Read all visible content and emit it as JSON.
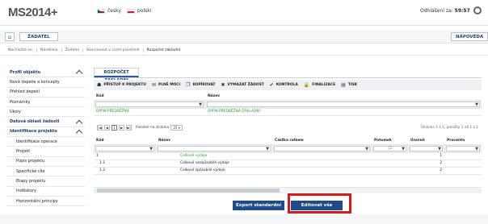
{
  "header": {
    "logo_main": "MS2014+",
    "lang_cz": "česky",
    "lang_pl": "polski",
    "logout_label": "Odhlášení za:",
    "logout_time": "59:57"
  },
  "navbar": {
    "zadatel": "ŽADATEL",
    "help": "NÁPOVĚDA"
  },
  "breadcrumb": [
    "Nacházíte se:",
    "Nástěnka",
    "Žadatel",
    "Kosmonaut v cizím prostředí",
    "Rozpočet základní"
  ],
  "sidebar": [
    {
      "label": "Profil objektu",
      "type": "sec",
      "chev": true
    },
    {
      "label": "Nová depeše a koncepty",
      "type": "item"
    },
    {
      "label": "Přehled depeší",
      "type": "item"
    },
    {
      "label": "Poznámky",
      "type": "item"
    },
    {
      "label": "Úkoly",
      "type": "item"
    },
    {
      "label": "Datová oblast žádosti",
      "type": "sec",
      "chev": true
    },
    {
      "label": "Identifikace projektu",
      "type": "sec",
      "chev": true
    },
    {
      "label": "Identifikace operace",
      "type": "sub"
    },
    {
      "label": "Projekt",
      "type": "sub"
    },
    {
      "label": "Popis projektu",
      "type": "sub"
    },
    {
      "label": "Specifické cíle",
      "type": "sub"
    },
    {
      "label": "Etapy projektu",
      "type": "sub"
    },
    {
      "label": "Indikátory",
      "type": "sub"
    },
    {
      "label": "Horizontální principy",
      "type": "sub"
    }
  ],
  "tab_title": "ROZPOČET ZÁKLADNÍ",
  "toolbar": [
    {
      "icon": "people-icon",
      "glyph": "☗",
      "label": "PŘÍSTUP K PROJEKTU"
    },
    {
      "icon": "mail-icon",
      "glyph": "✉",
      "label": "PLNÉ MOCI"
    },
    {
      "icon": "copy-icon",
      "glyph": "❐",
      "label": "KOPÍROVAT"
    },
    {
      "icon": "x-icon",
      "glyph": "✖",
      "label": "VYMAZAT ŽÁDOST"
    },
    {
      "icon": "check-icon",
      "glyph": "✔",
      "label": "KONTROLA"
    },
    {
      "icon": "lock-icon",
      "glyph": "🔒",
      "label": "FINALIZACE"
    },
    {
      "icon": "print-icon",
      "glyph": "▤",
      "label": "TISK"
    }
  ],
  "top_table": {
    "col_kod": "Kód",
    "col_nazev": "Název",
    "row_kod": "DPPIK-PŘEDBĚŽNÁ",
    "row_nazev": "DPPIK-PŘEDBĚŽNÁ-ZÁKLADNÍ"
  },
  "pager": {
    "prev_first": "|◀",
    "prev": "◀",
    "page": "1",
    "next": "▶",
    "next_last": "▶|",
    "per_page_label": "Položek na stránku",
    "per_page": "25",
    "info": "Stránka 1 z 1, položky 1 až 1 z 1"
  },
  "budget_table": {
    "cols": [
      "Kód",
      "Název",
      "Částka celkem",
      "Potomek",
      "Úroveň",
      "Procento"
    ],
    "rows": [
      {
        "kod": "1",
        "nazev": "Celkové výdaje",
        "castka": "",
        "uroven": "1",
        "green": true
      },
      {
        "kod": "1.1",
        "nazev": "Celkové nezpůsobilé výdaje",
        "castka": "",
        "uroven": "2",
        "green": false
      },
      {
        "kod": "1.2",
        "nazev": "Celkové způsobilé výdaje",
        "castka": "",
        "uroven": "2",
        "green": false
      }
    ]
  },
  "buttons": {
    "export": "Export standardní",
    "edit_all": "Editovat vše"
  },
  "colors": {
    "brand": "#1f4b8a",
    "highlight": "#d7191c",
    "green": "#2e9b2e"
  }
}
